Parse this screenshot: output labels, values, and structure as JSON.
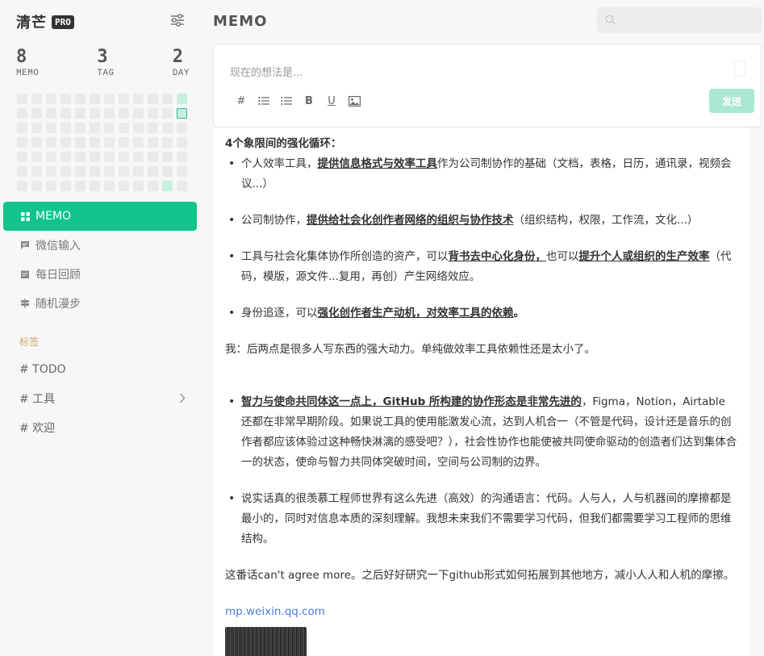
{
  "sidebar": {
    "brand": "清芒",
    "pro": "PRO",
    "stats": [
      {
        "num": "8",
        "label": "MEMO"
      },
      {
        "num": "3",
        "label": "TAG"
      },
      {
        "num": "2",
        "label": "DAY"
      }
    ],
    "nav": [
      {
        "label": "MEMO",
        "icon": "grid-icon"
      },
      {
        "label": "微信输入",
        "icon": "chat-icon"
      },
      {
        "label": "每日回顾",
        "icon": "calendar-icon"
      },
      {
        "label": "随机漫步",
        "icon": "signpost-icon"
      }
    ],
    "tags_title": "标签",
    "tags": [
      "# TODO",
      "# 工具",
      "# 欢迎"
    ]
  },
  "main": {
    "title": "MEMO",
    "search_placeholder": "",
    "editor_placeholder": "现在的想法是...",
    "send_label": "发送",
    "tools": [
      "#",
      "list-icon",
      "ordered-list-icon",
      "B",
      "U",
      "image-icon"
    ]
  },
  "memo": {
    "heading": "4个象限间的强化循环：",
    "b1_a": "个人效率工具，",
    "b1_b": "提供信息格式与效率工具",
    "b1_c": "作为公司制协作的基础（文档，表格，日历，通讯录，视频会议...）",
    "b2_a": "公司制协作，",
    "b2_b": "提供给社会化创作者网络的组织与协作技术",
    "b2_c": "（组织结构，权限，工作流，文化...）",
    "b3_a": "工具与社会化集体协作所创造的资产，可以",
    "b3_b": "背书去中心化身份，",
    "b3_c": "也可以",
    "b3_d": "提升个人或组织的生产效率",
    "b3_e": "（代码，模版，源文件...复用，再创）产生网络效应。",
    "b4_a": "身份追逐，可以",
    "b4_b": "强化创作者生产动机，对效率工具的依赖",
    "b4_c": "。",
    "p1": "我：后两点是很多人写东西的强大动力。单纯做效率工具依赖性还是太小了。",
    "b5_a": "智力与使命共同体这一点上，GitHub 所构建的协作形态是非常先进的",
    "b5_b": "，Figma，Notion，Airtable 还都在非常早期阶段。如果说工具的使用能激发心流，达到人机合一（不管是代码，设计还是音乐的创作者都应该体验过这种畅快淋漓的感受吧？），社会性协作也能使被共同使命驱动的创造者们达到集体合一的状态，使命与智力共同体突破时间，空间与公司制的边界。",
    "b6": "说实话真的很羡慕工程师世界有这么先进（高效）的沟通语言：代码。人与人，人与机器间的摩擦都是最小的，同时对信息本质的深刻理解。我想未来我们不需要学习代码，但我们都需要学习工程师的思维结构。",
    "p2": "这番话can't agree more。之后好好研究一下github形式如何拓展到其他地方，减小人人和人机的摩擦。",
    "link": "mp.weixin.qq.com"
  },
  "colors": {
    "accent": "#10c48c",
    "tag_title": "#d3a36b",
    "link": "#4c7be0"
  }
}
